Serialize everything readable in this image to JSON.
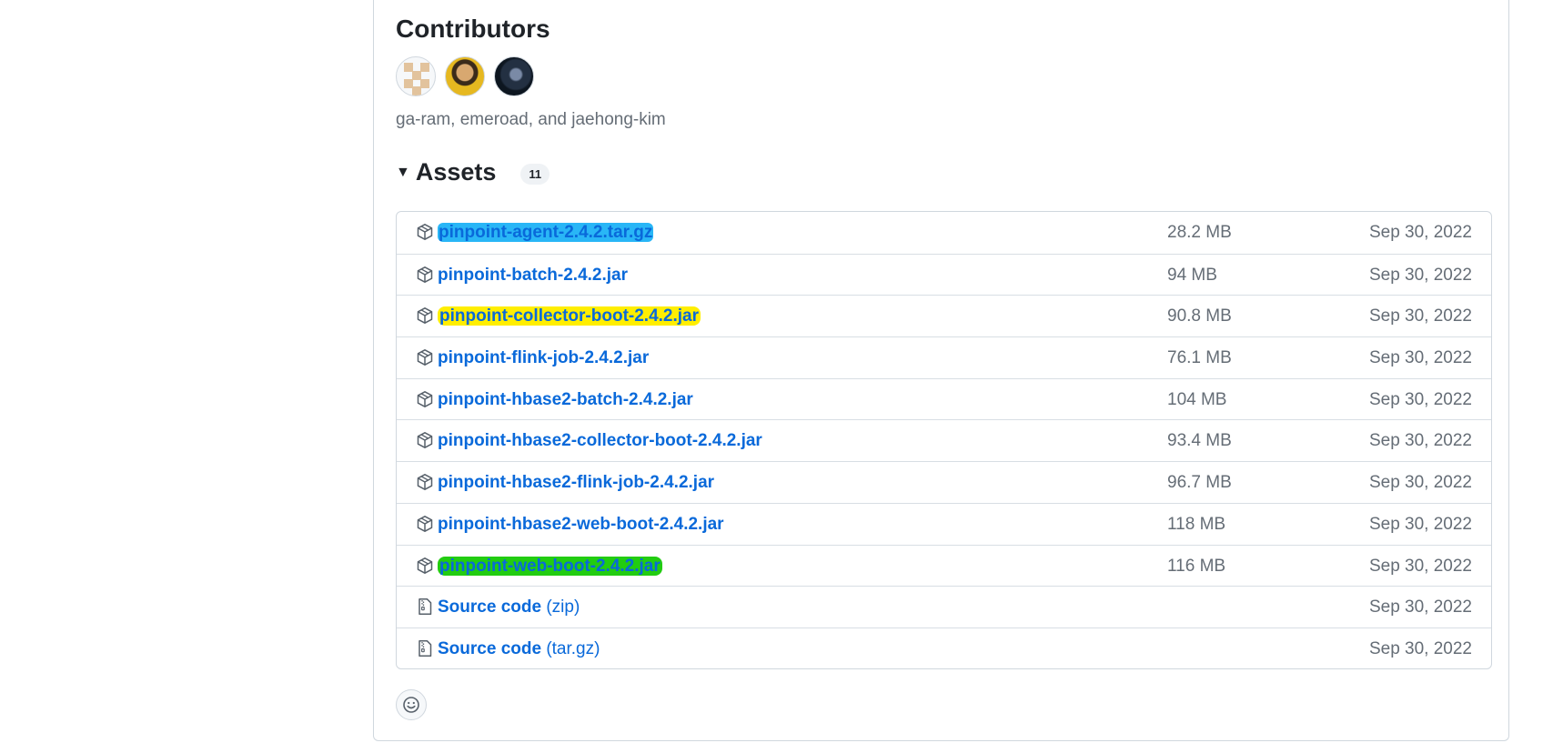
{
  "contributors": {
    "title": "Contributors",
    "names": "ga-ram, emeroad, and jaehong-kim",
    "avatars": [
      {
        "alt": "ga-ram"
      },
      {
        "alt": "emeroad"
      },
      {
        "alt": "jaehong-kim"
      }
    ]
  },
  "assets": {
    "title": "Assets",
    "count": "11",
    "items": [
      {
        "name": "pinpoint-agent-2.4.2.tar.gz",
        "suffix": "",
        "size": "28.2 MB",
        "date": "Sep 30, 2022",
        "icon": "package-icon",
        "highlight": "blue"
      },
      {
        "name": "pinpoint-batch-2.4.2.jar",
        "suffix": "",
        "size": "94 MB",
        "date": "Sep 30, 2022",
        "icon": "package-icon",
        "highlight": ""
      },
      {
        "name": "pinpoint-collector-boot-2.4.2.jar",
        "suffix": "",
        "size": "90.8 MB",
        "date": "Sep 30, 2022",
        "icon": "package-icon",
        "highlight": "yellow"
      },
      {
        "name": "pinpoint-flink-job-2.4.2.jar",
        "suffix": "",
        "size": "76.1 MB",
        "date": "Sep 30, 2022",
        "icon": "package-icon",
        "highlight": ""
      },
      {
        "name": "pinpoint-hbase2-batch-2.4.2.jar",
        "suffix": "",
        "size": "104 MB",
        "date": "Sep 30, 2022",
        "icon": "package-icon",
        "highlight": ""
      },
      {
        "name": "pinpoint-hbase2-collector-boot-2.4.2.jar",
        "suffix": "",
        "size": "93.4 MB",
        "date": "Sep 30, 2022",
        "icon": "package-icon",
        "highlight": ""
      },
      {
        "name": "pinpoint-hbase2-flink-job-2.4.2.jar",
        "suffix": "",
        "size": "96.7 MB",
        "date": "Sep 30, 2022",
        "icon": "package-icon",
        "highlight": ""
      },
      {
        "name": "pinpoint-hbase2-web-boot-2.4.2.jar",
        "suffix": "",
        "size": "118 MB",
        "date": "Sep 30, 2022",
        "icon": "package-icon",
        "highlight": ""
      },
      {
        "name": "pinpoint-web-boot-2.4.2.jar",
        "suffix": "",
        "size": "116 MB",
        "date": "Sep 30, 2022",
        "icon": "package-icon",
        "highlight": "green"
      },
      {
        "name": "Source code",
        "suffix": " (zip)",
        "size": "",
        "date": "Sep 30, 2022",
        "icon": "file-zip-icon",
        "highlight": ""
      },
      {
        "name": "Source code",
        "suffix": " (tar.gz)",
        "size": "",
        "date": "Sep 30, 2022",
        "icon": "file-zip-icon",
        "highlight": ""
      }
    ]
  },
  "reactions": {
    "icon": "smiley-icon"
  },
  "colors": {
    "link": "#0969da",
    "muted": "#656d76",
    "border": "#d0d7de",
    "highlight_blue": "#29b6f6",
    "highlight_yellow": "#ffee00",
    "highlight_green": "#22cc11"
  }
}
